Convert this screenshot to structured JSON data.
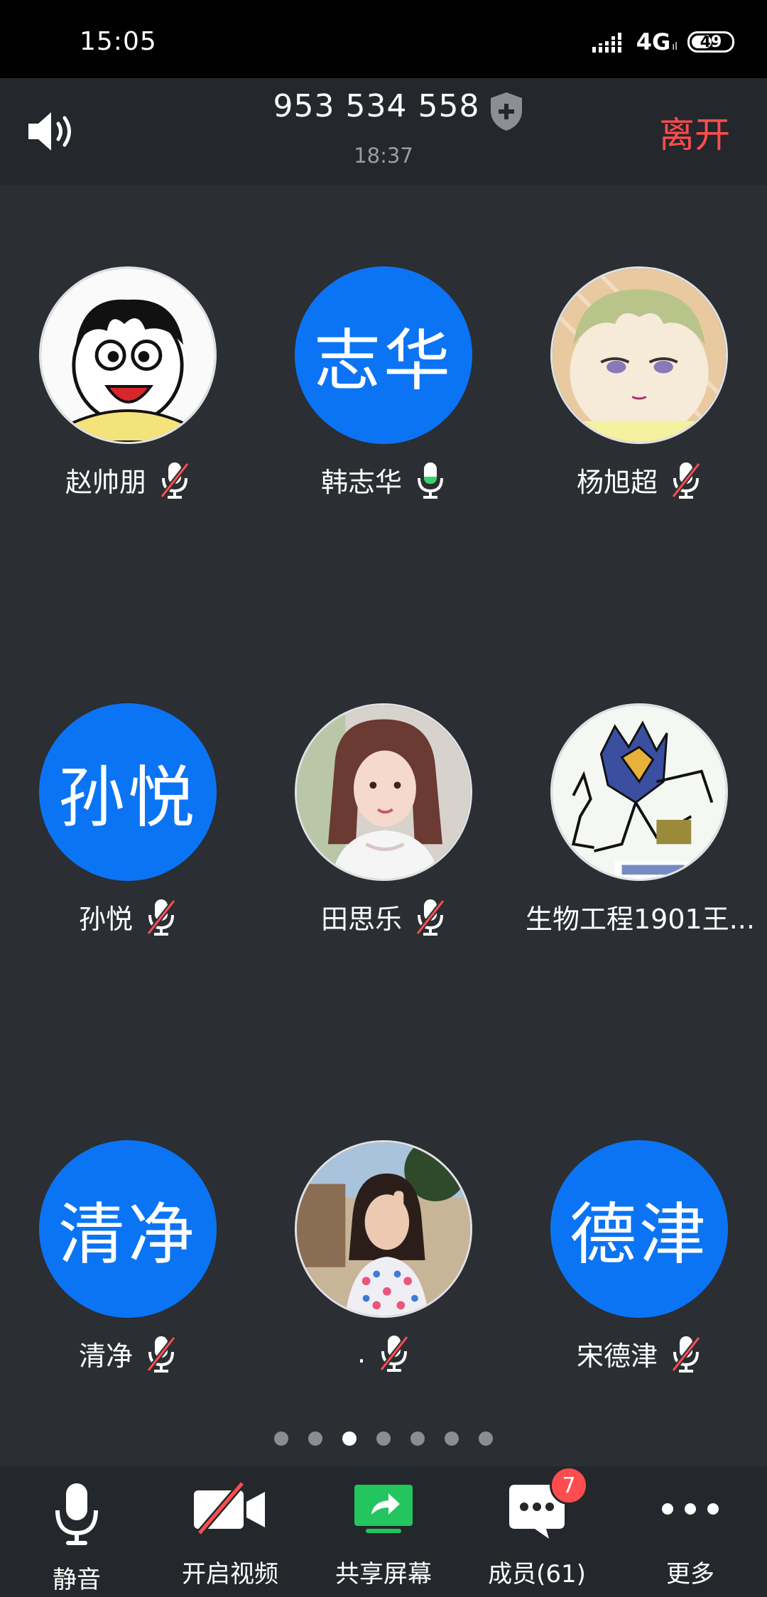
{
  "status_bar": {
    "time": "15:05",
    "network": "4G",
    "network_sub": "ıl",
    "battery": "49"
  },
  "header": {
    "meeting_id": "953 534 558",
    "elapsed": "18:37",
    "leave_label": "离开",
    "leave_color": "#ff4d4f"
  },
  "participants": [
    {
      "name": "赵帅朋",
      "avatar": "photo-cartoon-boy",
      "mic": "muted"
    },
    {
      "name": "韩志华",
      "initials": "志华",
      "mic": "active"
    },
    {
      "name": "杨旭超",
      "avatar": "photo-anime-baby",
      "mic": "muted"
    },
    {
      "name": "孙悦",
      "initials": "孙悦",
      "mic": "muted"
    },
    {
      "name": "田思乐",
      "avatar": "photo-girl-portrait",
      "mic": "muted"
    },
    {
      "name": "生物工程1901王...",
      "avatar": "photo-meme-drawing",
      "mic": "muted"
    },
    {
      "name": "清净",
      "initials": "清净",
      "mic": "muted"
    },
    {
      "name": ".",
      "avatar": "photo-girl-outdoor",
      "mic": "muted"
    },
    {
      "name": "宋德津",
      "initials": "德津",
      "mic": "muted"
    }
  ],
  "pagination": {
    "total": 7,
    "current": 3
  },
  "toolbar": {
    "mute_label": "静音",
    "video_label": "开启视频",
    "share_label": "共享屏幕",
    "members_label": "成员(61)",
    "members_badge": "7",
    "more_label": "更多"
  },
  "colors": {
    "accent_blue": "#0b74f5",
    "share_green": "#22c55e",
    "muted_red": "#ff4d4f",
    "mic_active_green": "#3ad36b"
  }
}
